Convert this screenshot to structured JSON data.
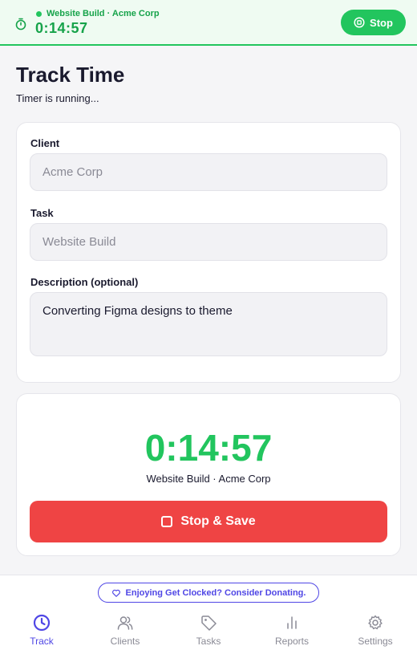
{
  "topbar": {
    "project_label": "Website Build · Acme Corp",
    "elapsed": "0:14:57",
    "stop_label": "Stop"
  },
  "header": {
    "title": "Track Time",
    "subtitle": "Timer is running..."
  },
  "form": {
    "client_label": "Client",
    "client_value": "Acme Corp",
    "task_label": "Task",
    "task_value": "Website Build",
    "description_label": "Description (optional)",
    "description_value": "Converting Figma designs to theme"
  },
  "timer_card": {
    "time": "0:14:57",
    "subtitle": "Website Build · Acme Corp",
    "save_label": "Stop & Save"
  },
  "footer": {
    "donate_label": "Enjoying Get Clocked? Consider Donating.",
    "tabs": [
      {
        "label": "Track",
        "icon": "clock-icon",
        "active": true
      },
      {
        "label": "Clients",
        "icon": "users-icon",
        "active": false
      },
      {
        "label": "Tasks",
        "icon": "tag-icon",
        "active": false
      },
      {
        "label": "Reports",
        "icon": "bar-chart-icon",
        "active": false
      },
      {
        "label": "Settings",
        "icon": "gear-icon",
        "active": false
      }
    ]
  },
  "colors": {
    "accent_green": "#22c55e",
    "danger_red": "#ef4444",
    "brand_indigo": "#4f46e5"
  }
}
